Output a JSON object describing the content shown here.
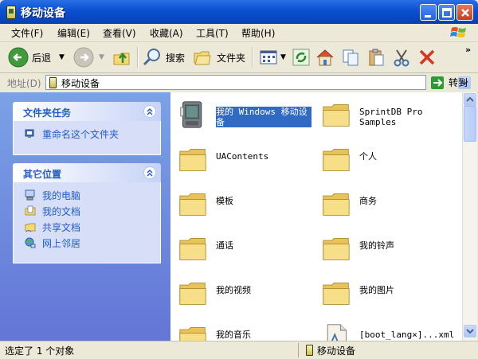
{
  "window": {
    "title": "移动设备"
  },
  "menu": {
    "items": [
      "文件(F)",
      "编辑(E)",
      "查看(V)",
      "收藏(A)",
      "工具(T)",
      "帮助(H)"
    ]
  },
  "toolbar": {
    "back_label": "后退",
    "search_label": "搜索",
    "folders_label": "文件夹"
  },
  "address": {
    "label": "地址(D)",
    "value": "移动设备",
    "go_label": "转到"
  },
  "taskpane": {
    "file_tasks": {
      "title": "文件夹任务",
      "items": [
        "重命名这个文件夹"
      ]
    },
    "other_places": {
      "title": "其它位置",
      "items": [
        "我的电脑",
        "我的文档",
        "共享文档",
        "网上邻居"
      ]
    }
  },
  "files": {
    "items": [
      {
        "name": "我的 Windows 移动设备",
        "icon": "pda-device-icon",
        "selected": true
      },
      {
        "name": "SprintDB Pro Samples",
        "icon": "folder-icon"
      },
      {
        "name": "UAContents",
        "icon": "folder-icon"
      },
      {
        "name": "个人",
        "icon": "folder-icon"
      },
      {
        "name": "模板",
        "icon": "folder-icon"
      },
      {
        "name": "商务",
        "icon": "folder-icon"
      },
      {
        "name": "通话",
        "icon": "folder-icon"
      },
      {
        "name": "我的铃声",
        "icon": "folder-icon"
      },
      {
        "name": "我的视频",
        "icon": "folder-icon"
      },
      {
        "name": "我的图片",
        "icon": "folder-icon"
      },
      {
        "name": "我的音乐",
        "icon": "folder-icon"
      },
      {
        "name": "[boot_lang×]...xml",
        "icon": "document-icon"
      }
    ]
  },
  "status": {
    "left": "选定了 1 个对象",
    "right": "移动设备"
  },
  "colors": {
    "titlebar": "#0a4fd0",
    "taskpane_link": "#215dc6",
    "selection": "#316ac5",
    "folder_yellow": "#f3d978"
  }
}
